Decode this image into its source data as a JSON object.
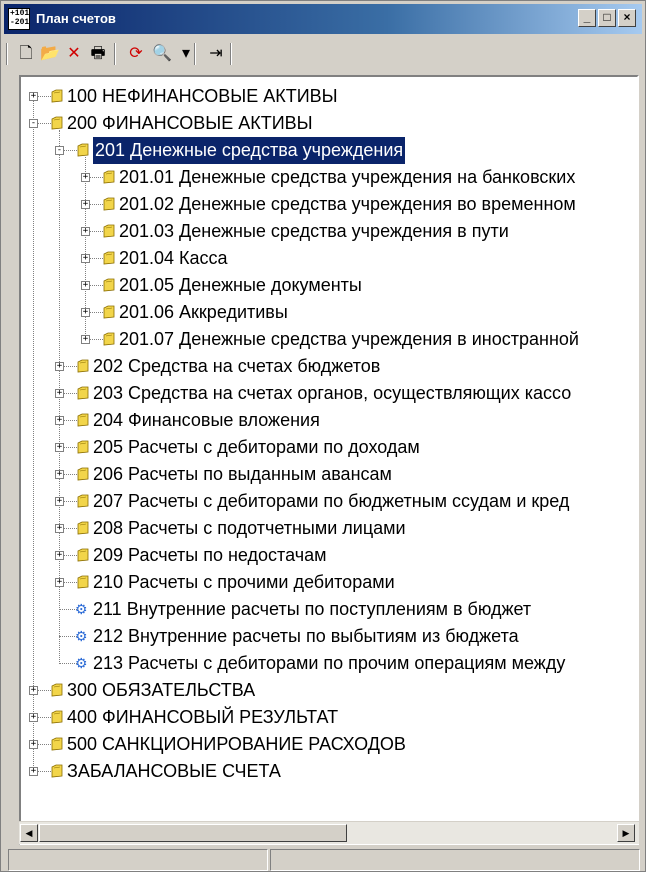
{
  "window": {
    "title": "План счетов",
    "icon_text": "+101 -201"
  },
  "title_buttons": {
    "minimize": "_",
    "maximize": "□",
    "close": "×"
  },
  "toolbar": [
    {
      "name": "new-icon",
      "glyph": "🗋"
    },
    {
      "name": "open-folder-icon",
      "glyph": "📂"
    },
    {
      "name": "delete-icon",
      "glyph": "✕"
    },
    {
      "name": "print-icon",
      "glyph": "🖶"
    },
    {
      "name": "refresh-icon",
      "glyph": "⟳"
    },
    {
      "name": "search-icon",
      "glyph": "🔍"
    },
    {
      "name": "dropdown-arrow-icon",
      "glyph": "▾"
    },
    {
      "name": "exit-icon",
      "glyph": "⇥"
    }
  ],
  "tree": [
    {
      "level": 0,
      "label": "100 НЕФИНАНСОВЫЕ АКТИВЫ",
      "expander": "+",
      "icon": "folder"
    },
    {
      "level": 0,
      "label": "200 ФИНАНСОВЫЕ АКТИВЫ",
      "expander": "-",
      "icon": "folder"
    },
    {
      "level": 1,
      "label": "201 Денежные средства учреждения",
      "expander": "-",
      "icon": "folder",
      "selected": true
    },
    {
      "level": 2,
      "label": "201.01 Денежные средства учреждения на банковских",
      "expander": "+",
      "icon": "folder"
    },
    {
      "level": 2,
      "label": "201.02 Денежные средства учреждения во временном",
      "expander": "+",
      "icon": "folder"
    },
    {
      "level": 2,
      "label": "201.03 Денежные средства учреждения в пути",
      "expander": "+",
      "icon": "folder"
    },
    {
      "level": 2,
      "label": "201.04 Касса",
      "expander": "+",
      "icon": "folder"
    },
    {
      "level": 2,
      "label": "201.05 Денежные документы",
      "expander": "+",
      "icon": "folder"
    },
    {
      "level": 2,
      "label": "201.06 Аккредитивы",
      "expander": "+",
      "icon": "folder"
    },
    {
      "level": 2,
      "label": "201.07 Денежные средства учреждения в иностранной",
      "expander": "+",
      "icon": "folder"
    },
    {
      "level": 1,
      "label": "202 Средства на счетах бюджетов",
      "expander": "+",
      "icon": "folder"
    },
    {
      "level": 1,
      "label": "203 Средства на счетах органов, осуществляющих кассо",
      "expander": "+",
      "icon": "folder"
    },
    {
      "level": 1,
      "label": "204 Финансовые вложения",
      "expander": "+",
      "icon": "folder"
    },
    {
      "level": 1,
      "label": "205 Расчеты с дебиторами по доходам",
      "expander": "+",
      "icon": "folder"
    },
    {
      "level": 1,
      "label": "206 Расчеты по выданным авансам",
      "expander": "+",
      "icon": "folder"
    },
    {
      "level": 1,
      "label": "207 Расчеты с дебиторами по бюджетным ссудам и кред",
      "expander": "+",
      "icon": "folder"
    },
    {
      "level": 1,
      "label": "208 Расчеты с подотчетными лицами",
      "expander": "+",
      "icon": "folder"
    },
    {
      "level": 1,
      "label": "209 Расчеты по недостачам",
      "expander": "+",
      "icon": "folder"
    },
    {
      "level": 1,
      "label": "210 Расчеты с прочими дебиторами",
      "expander": "+",
      "icon": "folder"
    },
    {
      "level": 1,
      "label": "211 Внутренние расчеты по поступлениям в бюджет",
      "expander": "",
      "icon": "gear"
    },
    {
      "level": 1,
      "label": "212 Внутренние расчеты по выбытиям из бюджета",
      "expander": "",
      "icon": "gear"
    },
    {
      "level": 1,
      "label": "213 Расчеты с дебиторами по прочим операциям между",
      "expander": "",
      "icon": "gear"
    },
    {
      "level": 0,
      "label": "300 ОБЯЗАТЕЛЬСТВА",
      "expander": "+",
      "icon": "folder"
    },
    {
      "level": 0,
      "label": "400 ФИНАНСОВЫЙ РЕЗУЛЬТАТ",
      "expander": "+",
      "icon": "folder"
    },
    {
      "level": 0,
      "label": "500 САНКЦИОНИРОВАНИЕ РАСХОДОВ",
      "expander": "+",
      "icon": "folder"
    },
    {
      "level": 0,
      "label": "ЗАБАЛАНСОВЫЕ СЧЕТА",
      "expander": "+",
      "icon": "folder"
    }
  ],
  "scrollbar": {
    "left_arrow": "◀",
    "right_arrow": "▶"
  },
  "colors": {
    "selection": "#0a246a",
    "folder": "#f2d54a",
    "gear": "#2c6bd6"
  }
}
